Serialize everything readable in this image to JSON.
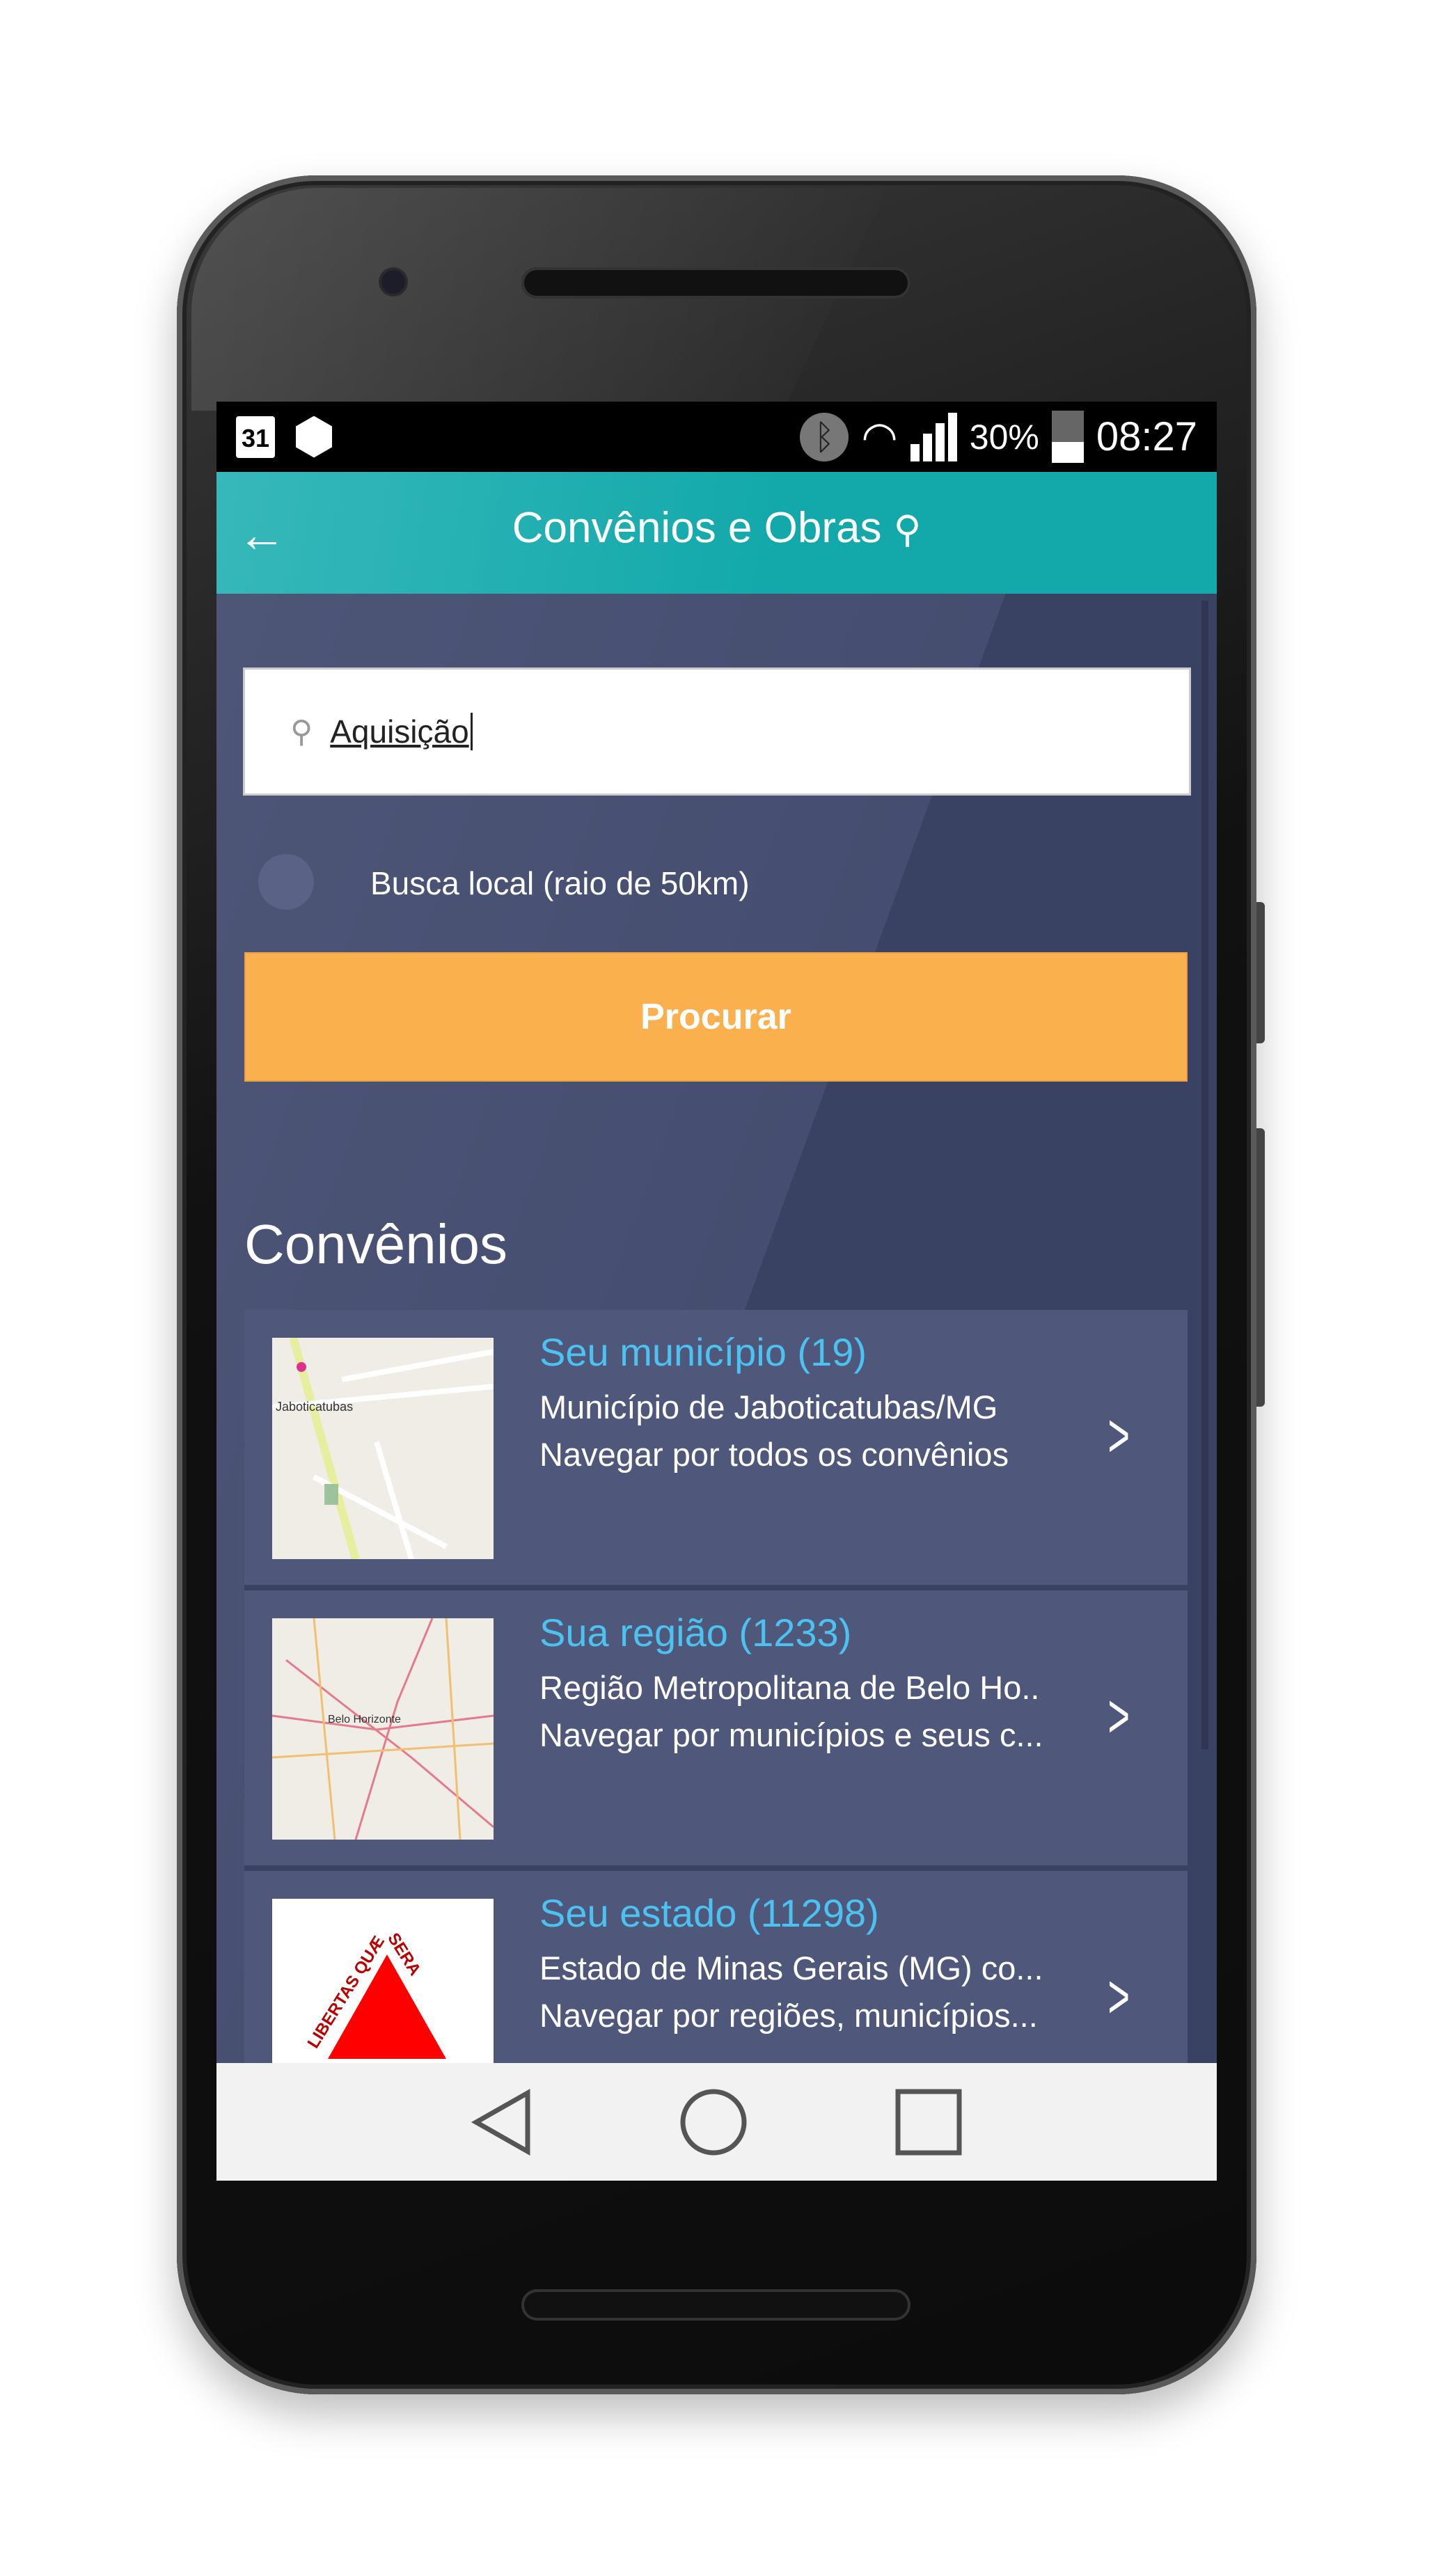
{
  "status_bar": {
    "calendar_day": "31",
    "battery": "30%",
    "time": "08:27"
  },
  "app_bar": {
    "title": "Convênios e Obras"
  },
  "search": {
    "value": "Aquisição"
  },
  "local_search_label": "Busca local (raio de 50km)",
  "search_button": "Procurar",
  "section_title": "Convênios",
  "items": [
    {
      "title": "Seu município (19)",
      "line1": "Município de Jaboticatubas/MG",
      "line2": "Navegar por todos os convênios",
      "thumb_label": "Jaboticatubas"
    },
    {
      "title": "Sua região (1233)",
      "line1": "Região Metropolitana de Belo Ho..",
      "line2": "Navegar por municípios e seus c...",
      "thumb_label": "Belo Horizonte"
    },
    {
      "title": "Seu estado (11298)",
      "line1": "Estado de Minas Gerais (MG) co...",
      "line2": "Navegar por regiões, municípios...",
      "thumb_label": "LIBERTAS QUÆ SERA"
    }
  ]
}
